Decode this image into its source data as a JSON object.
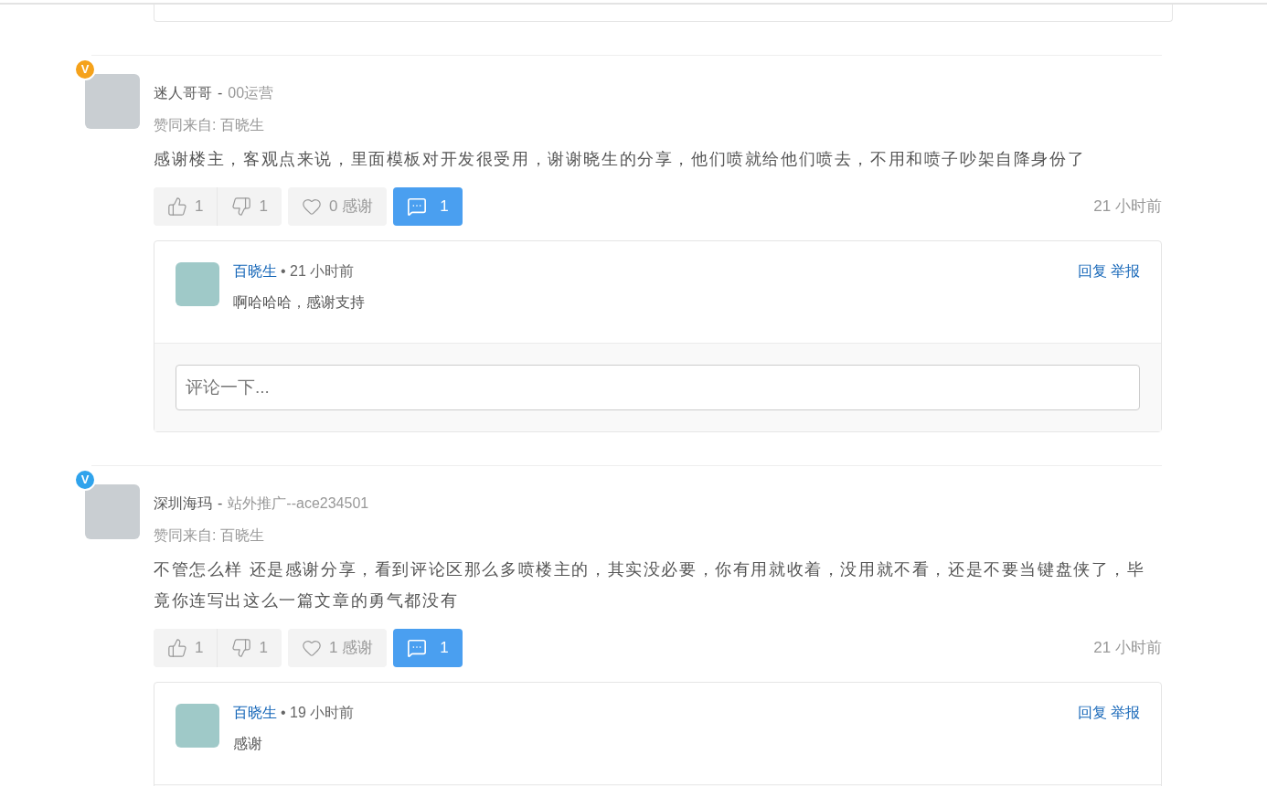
{
  "comments": [
    {
      "badge": {
        "text": "V",
        "color": "#f5a21b"
      },
      "author": "迷人哥哥",
      "dash": "-",
      "group": "00运营",
      "agreed_by": "赞同来自: 百晓生",
      "text": "感谢楼主，客观点来说，里面模板对开发很受用，谢谢晓生的分享，他们喷就给他们喷去，不用和喷子吵架自降身份了",
      "likes": "1",
      "dislikes": "1",
      "thanks": "0 感谢",
      "reply_count": "1",
      "time": "21 小时前",
      "replies": [
        {
          "author": "百晓生",
          "time": "• 21 小时前",
          "text": "啊哈哈哈，感谢支持",
          "actions": [
            "回复",
            "举报"
          ]
        }
      ],
      "comment_box": {
        "placeholder": "评论一下..."
      }
    },
    {
      "badge": {
        "text": "V",
        "color": "#2fa3ec"
      },
      "author": "深圳海玛",
      "dash": "-",
      "group": "站外推广--ace234501",
      "agreed_by": "赞同来自: 百晓生",
      "text": "不管怎么样 还是感谢分享，看到评论区那么多喷楼主的，其实没必要，你有用就收着，没用就不看，还是不要当键盘侠了，毕竟你连写出这么一篇文章的勇气都没有",
      "likes": "1",
      "dislikes": "1",
      "thanks": "1 感谢",
      "reply_count": "1",
      "time": "21 小时前",
      "replies": [
        {
          "author": "百晓生",
          "time": "• 19 小时前",
          "text": "感谢",
          "actions": [
            "回复",
            "举报"
          ]
        }
      ]
    }
  ]
}
